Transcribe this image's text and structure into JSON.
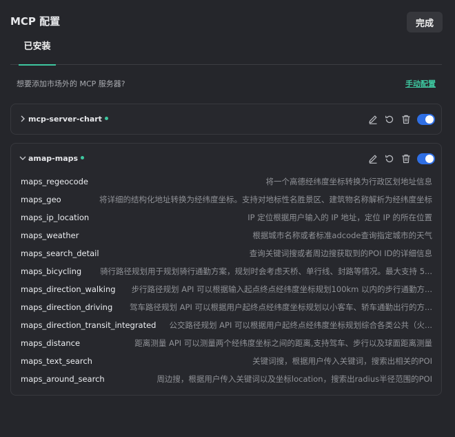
{
  "header": {
    "title": "MCP 配置",
    "done_label": "完成"
  },
  "tabs": [
    {
      "label": "已安装"
    }
  ],
  "hint": {
    "text": "想要添加市场外的 MCP 服务器?",
    "link_label": "手动配置"
  },
  "servers": [
    {
      "name": "mcp-server-chart",
      "status_color": "#3ec7a0",
      "expanded": false,
      "enabled": true
    },
    {
      "name": "amap-maps",
      "status_color": "#3ec7a0",
      "expanded": true,
      "enabled": true,
      "tools": [
        {
          "name": "maps_regeocode",
          "desc": "将一个高德经纬度坐标转换为行政区划地址信息"
        },
        {
          "name": "maps_geo",
          "desc": "将详细的结构化地址转换为经纬度坐标。支持对地标性名胜景区、建筑物名称解析为经纬度坐标"
        },
        {
          "name": "maps_ip_location",
          "desc": "IP 定位根据用户输入的 IP 地址，定位 IP 的所在位置"
        },
        {
          "name": "maps_weather",
          "desc": "根据城市名称或者标准adcode查询指定城市的天气"
        },
        {
          "name": "maps_search_detail",
          "desc": "查询关键词搜或者周边搜获取到的POI ID的详细信息"
        },
        {
          "name": "maps_bicycling",
          "desc": "骑行路径规划用于规划骑行通勤方案，规划时会考虑天桥、单行线、封路等情况。最大支持 5..."
        },
        {
          "name": "maps_direction_walking",
          "desc": "步行路径规划 API 可以根据输入起点终点经纬度坐标规划100km 以内的步行通勤方..."
        },
        {
          "name": "maps_direction_driving",
          "desc": "驾车路径规划 API 可以根据用户起终点经纬度坐标规划以小客车、轿车通勤出行的方..."
        },
        {
          "name": "maps_direction_transit_integrated",
          "desc": "公交路径规划 API 可以根据用户起终点经纬度坐标规划综合各类公共（火..."
        },
        {
          "name": "maps_distance",
          "desc": "距离测量 API 可以测量两个经纬度坐标之间的距离,支持驾车、步行以及球面距离测量"
        },
        {
          "name": "maps_text_search",
          "desc": "关键词搜，根据用户传入关键词，搜索出相关的POI"
        },
        {
          "name": "maps_around_search",
          "desc": "周边搜，根据用户传入关键词以及坐标location，搜索出radius半径范围的POI"
        }
      ]
    }
  ],
  "icons": {
    "edit": "edit-icon",
    "refresh": "refresh-icon",
    "trash": "trash-icon",
    "collapsed": "chevron-right-icon",
    "expanded": "chevron-down-icon"
  }
}
